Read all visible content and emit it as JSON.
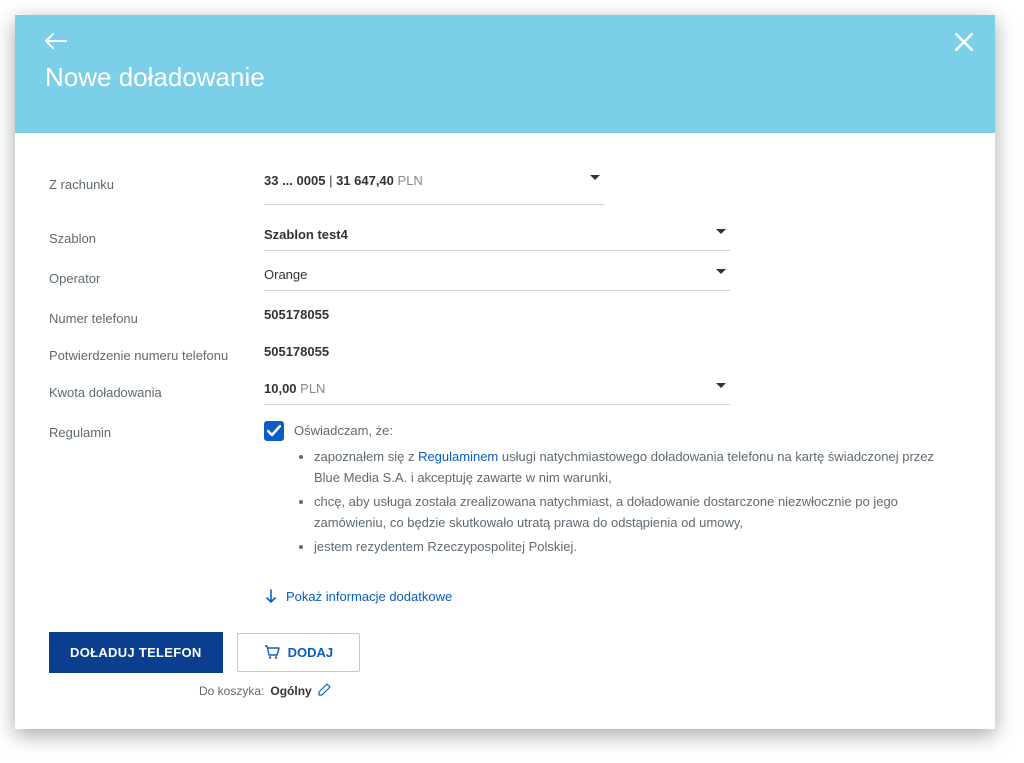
{
  "header": {
    "title": "Nowe doładowanie"
  },
  "form": {
    "account_label": "Z rachunku",
    "account_number": "33 ... 0005",
    "account_sep": " | ",
    "account_balance": "31 647,40",
    "account_currency": " PLN",
    "template_label": "Szablon",
    "template_value": "Szablon test4",
    "operator_label": "Operator",
    "operator_value": "Orange",
    "phone_label": "Numer telefonu",
    "phone_value": "505178055",
    "phone_confirm_label": "Potwierdzenie numeru telefonu",
    "phone_confirm_value": "505178055",
    "amount_label": "Kwota doładowania",
    "amount_value": "10,00",
    "amount_currency": " PLN",
    "reg_label": "Regulamin",
    "reg_intro": "Oświadczam, że:",
    "reg_bullet1_a": "zapoznałem się z ",
    "reg_bullet1_link": "Regulaminem",
    "reg_bullet1_b": " usługi natychmiastowego doładowania telefonu na kartę świadczonej przez Blue Media S.A. i akceptuję zawarte w nim warunki,",
    "reg_bullet2": "chcę, aby usługa została zrealizowana natychmiast, a doładowanie dostarczone niezwłocznie po jego zamówieniu, co będzie skutkowało utratą prawa do odstąpienia od umowy,",
    "reg_bullet3": "jestem rezydentem Rzeczypospolitej Polskiej.",
    "show_more": "Pokaż informacje dodatkowe"
  },
  "actions": {
    "primary": "DOŁADUJ TELEFON",
    "secondary": "DODAJ",
    "basket_prefix": "Do koszyka: ",
    "basket_name": "Ogólny"
  }
}
